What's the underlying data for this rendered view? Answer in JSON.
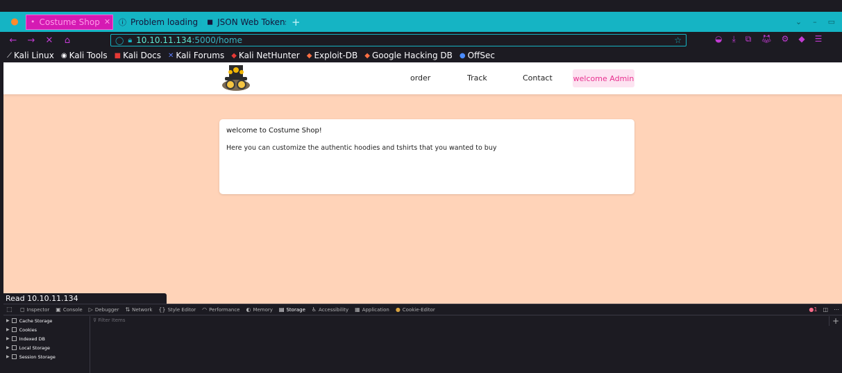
{
  "browser": {
    "tabs": [
      {
        "label": "Costume Shop",
        "active": true
      },
      {
        "label": "Problem loading pa",
        "active": false
      },
      {
        "label": "JSON Web Tokens",
        "active": false
      }
    ],
    "url": {
      "host": "10.10.11.134",
      "path": ":5000/home"
    },
    "bookmarks": [
      "Kali Linux",
      "Kali Tools",
      "Kali Docs",
      "Kali Forums",
      "Kali NetHunter",
      "Exploit-DB",
      "Google Hacking DB",
      "OffSec"
    ],
    "status_text": "Read 10.10.11.134"
  },
  "site": {
    "nav": {
      "order": "order",
      "track": "Track",
      "contact": "Contact",
      "welcome": "welcome Admin"
    },
    "card": {
      "title": "welcome to Costume Shop!",
      "body": "Here you can customize the authentic hoodies and tshirts that you wanted to buy"
    }
  },
  "devtools": {
    "tabs": [
      "Inspector",
      "Console",
      "Debugger",
      "Network",
      "Style Editor",
      "Performance",
      "Memory",
      "Storage",
      "Accessibility",
      "Application",
      "Cookie-Editor"
    ],
    "selected_tab": "Storage",
    "error_count": "1",
    "sidebar": [
      "Cache Storage",
      "Cookies",
      "Indexed DB",
      "Local Storage",
      "Session Storage"
    ],
    "filter_placeholder": "Filter Items"
  },
  "colors": {
    "accent": "#15b4c4",
    "active_tab": "#d51ab3",
    "page_bg": "#ffd3b8",
    "welcome_text": "#e8308f"
  }
}
